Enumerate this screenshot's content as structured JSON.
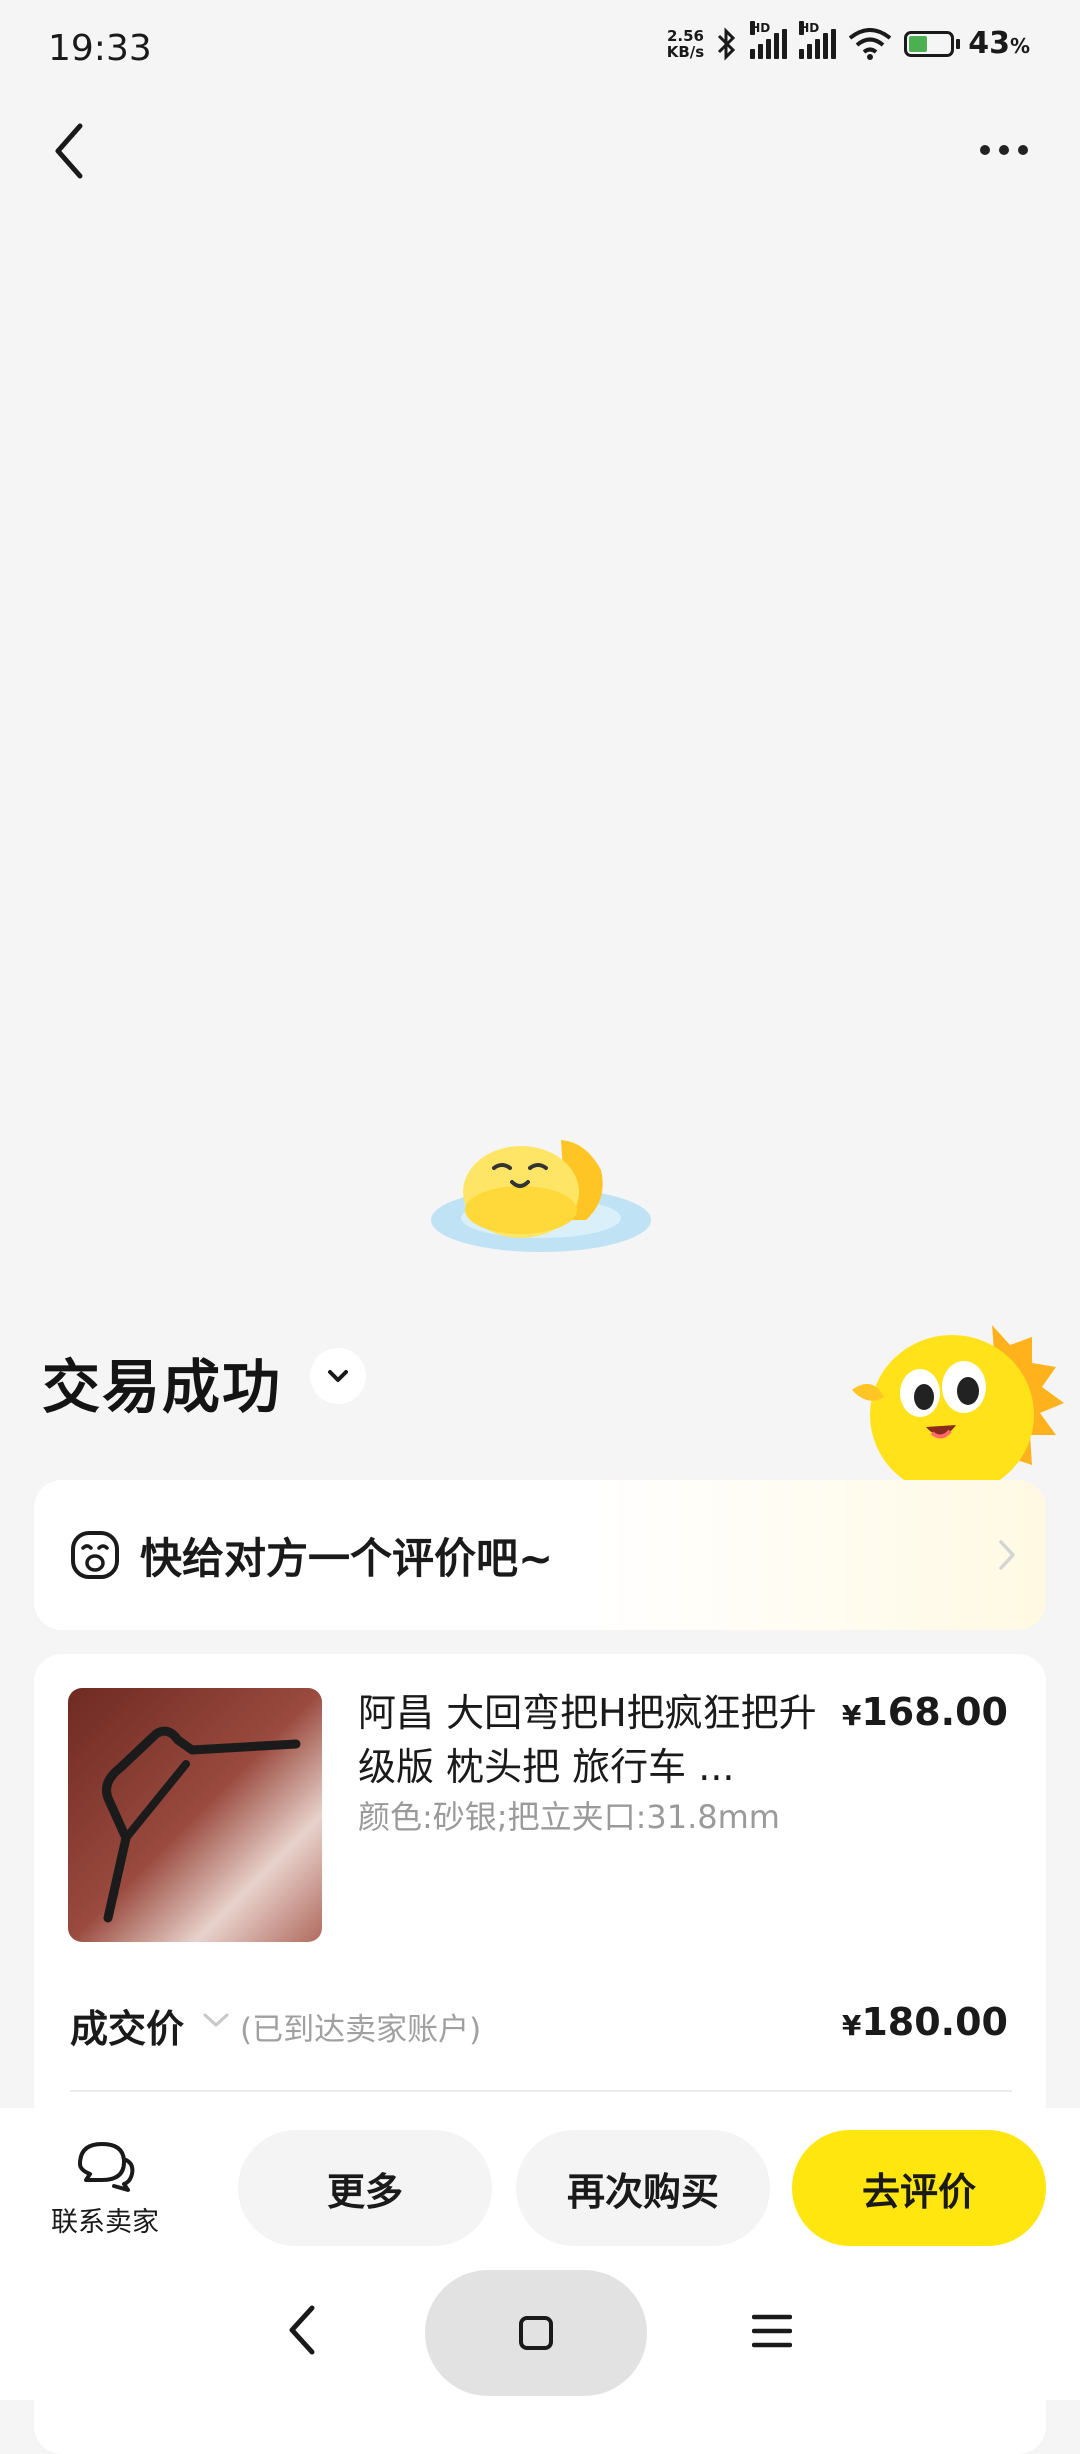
{
  "status_bar": {
    "time": "19:33",
    "net_speed_value": "2.56",
    "net_speed_unit": "KB/s",
    "hd_label": "HD",
    "battery_percent": "43",
    "battery_suffix": "%",
    "icons": [
      "bluetooth-icon",
      "signal-icon",
      "wifi-icon",
      "battery-icon"
    ]
  },
  "nav": {
    "back_icon": "back-arrow-icon",
    "more_icon": "more-dots-icon"
  },
  "order": {
    "status_title": "交易成功",
    "review_prompt": "快给对方一个评价吧~"
  },
  "product": {
    "name": "阿昌 大回弯把H把疯狂把升级版 枕头把 旅行车 ...",
    "spec": "颜色:砂银;把立夹口:31.8mm",
    "currency": "¥",
    "price": "168.00"
  },
  "deal": {
    "label": "成交价",
    "note": "(已到达卖家账户)",
    "currency": "¥",
    "price": "180.00"
  },
  "actions": {
    "contact_label": "联系卖家",
    "more_label": "更多",
    "rebuy_label": "再次购买",
    "review_label": "去评价"
  },
  "colors": {
    "accent_yellow": "#ffe60f",
    "background": "#f5f5f5",
    "battery_green": "#4caf50"
  }
}
